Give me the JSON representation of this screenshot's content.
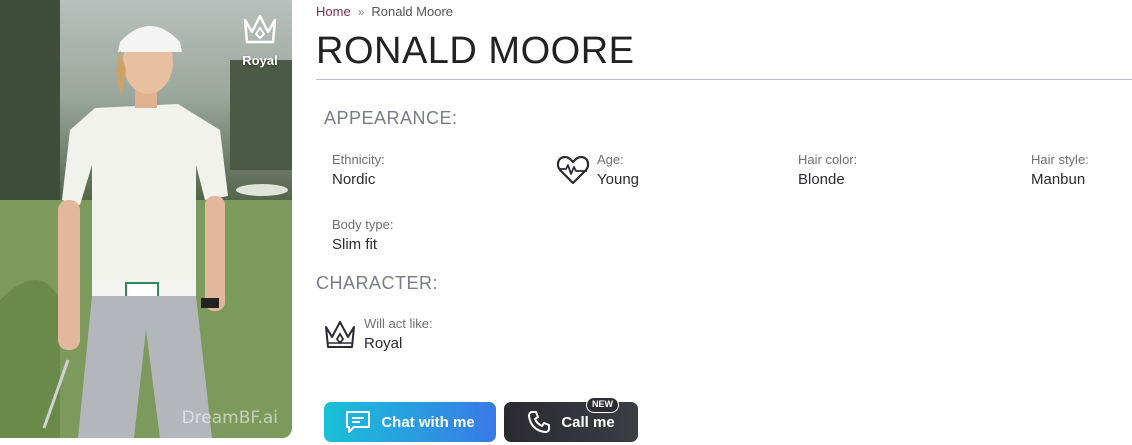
{
  "portrait": {
    "badge_label": "Royal",
    "badge_icon": "crown-icon",
    "watermark": "DreamBF.ai"
  },
  "breadcrumb": {
    "home": "Home",
    "separator": "»",
    "current": "Ronald Moore"
  },
  "title": "RONALD MOORE",
  "appearance": {
    "heading": "APPEARANCE:",
    "items": [
      {
        "label": "Ethnicity:",
        "value": "Nordic"
      },
      {
        "label": "Age:",
        "value": "Young",
        "icon": "heart-puzzle-icon"
      },
      {
        "label": "Hair color:",
        "value": "Blonde"
      },
      {
        "label": "Hair style:",
        "value": "Manbun"
      },
      {
        "label": "Body type:",
        "value": "Slim fit"
      }
    ]
  },
  "character": {
    "heading": "CHARACTER:",
    "label": "Will act like:",
    "value": "Royal",
    "icon": "crown-icon"
  },
  "actions": {
    "chat_label": "Chat with me",
    "call_label": "Call me",
    "new_tag": "NEW"
  },
  "colors": {
    "breadcrumb_home": "#7b2d55",
    "chat_start": "#19c1d8",
    "chat_end": "#3a7ae6",
    "call_bg": "#2a2a30"
  }
}
